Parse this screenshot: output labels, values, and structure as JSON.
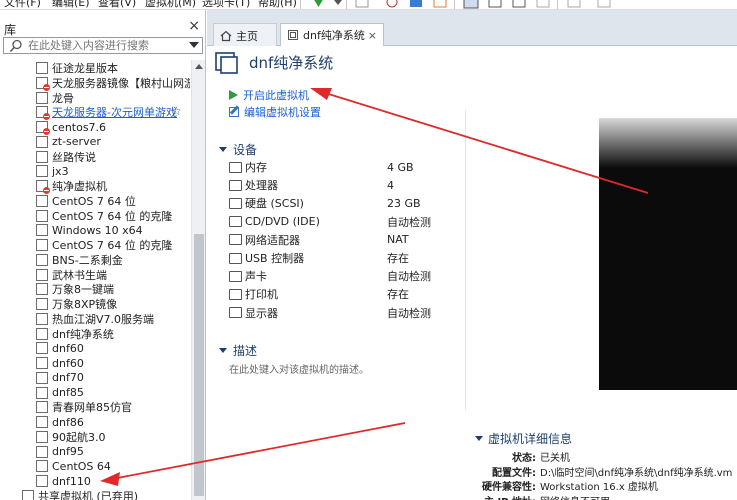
{
  "menubar": {
    "items": [
      "文件(F)",
      "编辑(E)",
      "查看(V)",
      "虚拟机(M)",
      "选项卡(T)",
      "帮助(H)"
    ]
  },
  "library": {
    "title": "库",
    "close": "×",
    "search_placeholder": "在此处键入内容进行搜索",
    "items": [
      {
        "label": "征途龙星版本",
        "status": "none"
      },
      {
        "label": "天龙服务器镜像【粮村山网游",
        "status": "error"
      },
      {
        "label": "龙骨",
        "status": "none"
      },
      {
        "label": "天龙服务器-次元网单游戏",
        "status": "error",
        "selected": true
      },
      {
        "label": "centos7.6",
        "status": "error"
      },
      {
        "label": "zt-server",
        "status": "none"
      },
      {
        "label": "丝路传说",
        "status": "none"
      },
      {
        "label": "jx3",
        "status": "none"
      },
      {
        "label": "纯净虚拟机",
        "status": "error"
      },
      {
        "label": "CentOS 7 64 位",
        "status": "none"
      },
      {
        "label": "CentOS 7 64 位 的克隆",
        "status": "none"
      },
      {
        "label": "Windows 10 x64",
        "status": "none"
      },
      {
        "label": "CentOS 7 64 位 的克隆",
        "status": "none"
      },
      {
        "label": "BNS-二系剩金",
        "status": "none"
      },
      {
        "label": "武林书生端",
        "status": "none"
      },
      {
        "label": "万象8一键端",
        "status": "none"
      },
      {
        "label": "万象8XP镜像",
        "status": "none"
      },
      {
        "label": "热血江湖V7.0服务端",
        "status": "none"
      },
      {
        "label": "dnf纯净系统",
        "status": "none"
      },
      {
        "label": "dnf60",
        "status": "none"
      },
      {
        "label": "dnf60",
        "status": "none"
      },
      {
        "label": "dnf70",
        "status": "none"
      },
      {
        "label": "dnf85",
        "status": "none"
      },
      {
        "label": "青春网单85仿官",
        "status": "none"
      },
      {
        "label": "dnf86",
        "status": "none"
      },
      {
        "label": "90起航3.0",
        "status": "none"
      },
      {
        "label": "dnf95",
        "status": "none"
      },
      {
        "label": "CentOS 64",
        "status": "none"
      },
      {
        "label": "dnf110",
        "status": "none"
      },
      {
        "label": "共享虚拟机 (已弃用)",
        "status": "shared"
      }
    ],
    "star": "☆"
  },
  "tabs": [
    {
      "label": "主页",
      "icon": "home-icon"
    },
    {
      "label": "dnf纯净系统",
      "icon": "vm-icon",
      "close": "×"
    }
  ],
  "vm": {
    "title": "dnf纯净系统",
    "actions": {
      "start": "开启此虚拟机",
      "edit": "编辑虚拟机设置"
    },
    "devices_title": "设备",
    "devices": [
      {
        "name": "内存",
        "value": "4 GB",
        "icon": "memory-icon"
      },
      {
        "name": "处理器",
        "value": "4",
        "icon": "cpu-icon"
      },
      {
        "name": "硬盘 (SCSI)",
        "value": "23 GB",
        "icon": "disk-icon"
      },
      {
        "name": "CD/DVD (IDE)",
        "value": "自动检测",
        "icon": "cdrom-icon"
      },
      {
        "name": "网络适配器",
        "value": "NAT",
        "icon": "network-icon"
      },
      {
        "name": "USB 控制器",
        "value": "存在",
        "icon": "usb-icon"
      },
      {
        "name": "声卡",
        "value": "自动检测",
        "icon": "sound-icon"
      },
      {
        "name": "打印机",
        "value": "存在",
        "icon": "printer-icon"
      },
      {
        "name": "显示器",
        "value": "自动检测",
        "icon": "monitor-icon"
      }
    ],
    "description_title": "描述",
    "description_placeholder": "在此处键入对该虚拟机的描述。",
    "details_title": "虚拟机详细信息",
    "details": [
      {
        "key": "状态:",
        "value": "已关机"
      },
      {
        "key": "配置文件:",
        "value": "D:\\临时空间\\dnf纯净系统\\dnf纯净系统.vm"
      },
      {
        "key": "硬件兼容性:",
        "value": "Workstation 16.x 虚拟机"
      },
      {
        "key": "主 IP 地址:",
        "value": "网络信息不可用"
      }
    ]
  },
  "colors": {
    "accent": "#1a5fd0",
    "annotation_arrow": "#e0292b",
    "play_green": "#2d9c3c",
    "error_red": "#e03a2f"
  }
}
